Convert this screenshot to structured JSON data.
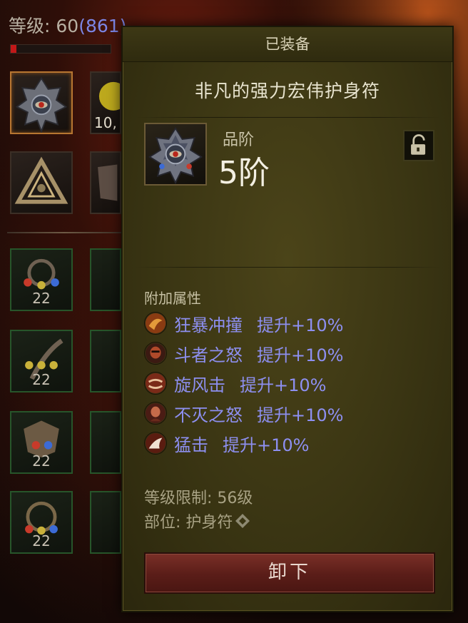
{
  "player": {
    "level_prefix": "等级: ",
    "level": "60",
    "paragon": "(861)",
    "xp_progress": 0.06
  },
  "inventory": {
    "slot_counts": [
      "22",
      "22",
      "22",
      "22"
    ],
    "stack_partial": "10,",
    "colors": {
      "red": "#c83a2a",
      "blue": "#3c6bd6",
      "yellow": "#c9b13a"
    }
  },
  "tooltip": {
    "header": "已装备",
    "item_name": "非凡的强力宏伟护身符",
    "grade_label": "品阶",
    "grade_value": "5阶",
    "lock_icon": "unlocked-padlock-icon",
    "affix_title": "附加属性",
    "affixes": [
      {
        "name": "狂暴冲撞",
        "bonus": "提升+10%",
        "icon": "frenzy-skill-icon"
      },
      {
        "name": "斗者之怒",
        "bonus": "提升+10%",
        "icon": "warlord-skill-icon"
      },
      {
        "name": "旋风击",
        "bonus": "提升+10%",
        "icon": "whirlwind-skill-icon"
      },
      {
        "name": "不灭之怒",
        "bonus": "提升+10%",
        "icon": "undying-rage-skill-icon"
      },
      {
        "name": "猛击",
        "bonus": "提升+10%",
        "icon": "lunge-skill-icon"
      }
    ],
    "level_req": "等级限制: 56级",
    "slot_label": "部位: 护身符",
    "unequip_label": "卸下",
    "colors": {
      "affix_text": "#8d8ff0",
      "panel_bg": "#3a3513",
      "button_bg": "#6a2620"
    }
  }
}
